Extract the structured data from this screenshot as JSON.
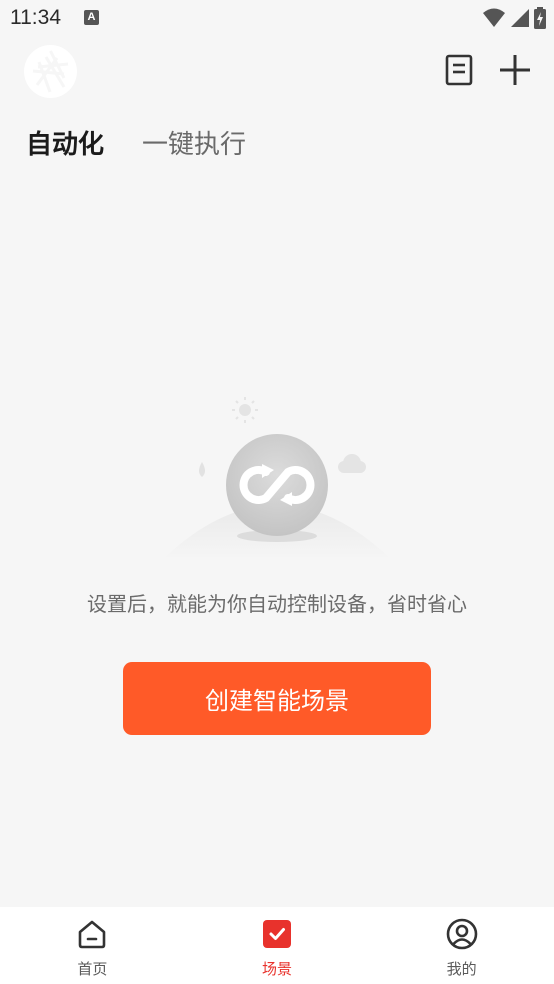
{
  "status_bar": {
    "time": "11:34",
    "notification_icon_letter": "A",
    "icons": [
      "wifi-icon",
      "signal-icon",
      "battery-charging-icon"
    ]
  },
  "header": {
    "logo_icon": "aperture-logo-icon",
    "actions": [
      {
        "icon": "document-icon"
      },
      {
        "icon": "plus-icon"
      }
    ]
  },
  "tabs": [
    {
      "label": "自动化",
      "active": true
    },
    {
      "label": "一键执行",
      "active": false
    }
  ],
  "empty_state": {
    "illustration_icon": "loop-sync-icon",
    "message": "设置后，就能为你自动控制设备，省时省心",
    "button_label": "创建智能场景"
  },
  "bottom_nav": [
    {
      "label": "首页",
      "icon": "home-icon",
      "active": false
    },
    {
      "label": "场景",
      "icon": "scene-check-icon",
      "active": true
    },
    {
      "label": "我的",
      "icon": "profile-icon",
      "active": false
    }
  ],
  "colors": {
    "accent": "#ff5a28",
    "nav_active": "#e8322c",
    "background": "#f6f6f6"
  }
}
